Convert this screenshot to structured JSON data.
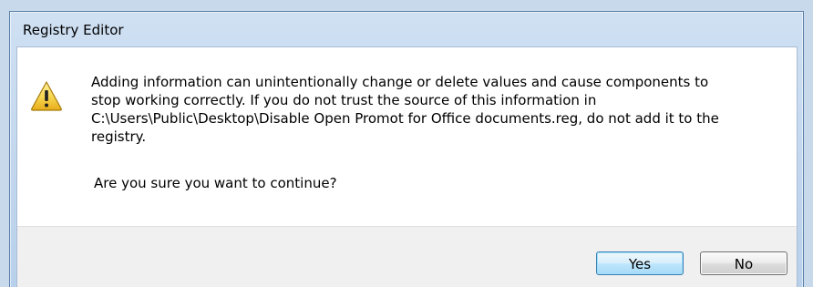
{
  "window": {
    "title": "Registry Editor"
  },
  "message": {
    "icon": "warning-icon",
    "text": "Adding information can unintentionally change or delete values and cause components to\nstop working correctly. If you do not trust the source of this information in\nC:\\Users\\Public\\Desktop\\Disable Open Promot for Office documents.reg, do not add it to the\nregistry.",
    "question": "Are you sure you want to continue?"
  },
  "buttons": {
    "yes_label": "Yes",
    "no_label": "No"
  },
  "colors": {
    "title_bar": "#c4d9f1",
    "footer": "#f0f0f0",
    "warning_fill": "#f6d44f",
    "default_button_border": "#3c7fb1"
  }
}
